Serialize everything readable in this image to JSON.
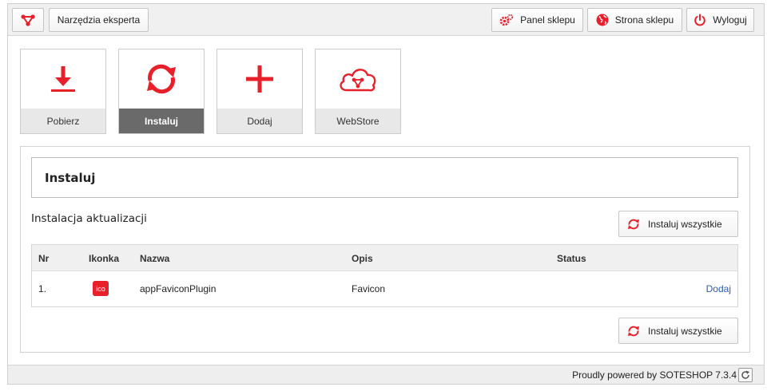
{
  "header": {
    "expert_tools_label": "Narzędzia eksperta",
    "shop_panel_label": "Panel sklepu",
    "shop_page_label": "Strona sklepu",
    "logout_label": "Wyloguj"
  },
  "tiles": [
    {
      "label": "Pobierz",
      "icon": "download-icon",
      "active": false
    },
    {
      "label": "Instaluj",
      "icon": "sync-icon",
      "active": true
    },
    {
      "label": "Dodaj",
      "icon": "plus-icon",
      "active": false
    },
    {
      "label": "WebStore",
      "icon": "cloud-share-icon",
      "active": false
    }
  ],
  "main": {
    "title": "Instaluj",
    "subtitle": "Instalacja aktualizacji",
    "install_all_label": "Instaluj wszystkie",
    "table": {
      "columns": [
        "Nr",
        "Ikonka",
        "Nazwa",
        "Opis",
        "Status"
      ],
      "rows": [
        {
          "nr": "1.",
          "icon_text": "ico",
          "name": "appFaviconPlugin",
          "description": "Favicon",
          "action": "Dodaj"
        }
      ]
    }
  },
  "footer": {
    "powered_by": "Proudly powered by SOTESHOP 7.3.4"
  },
  "colors": {
    "accent": "#e8202a",
    "link": "#2a5db0",
    "active_tile": "#6a6a6a"
  }
}
